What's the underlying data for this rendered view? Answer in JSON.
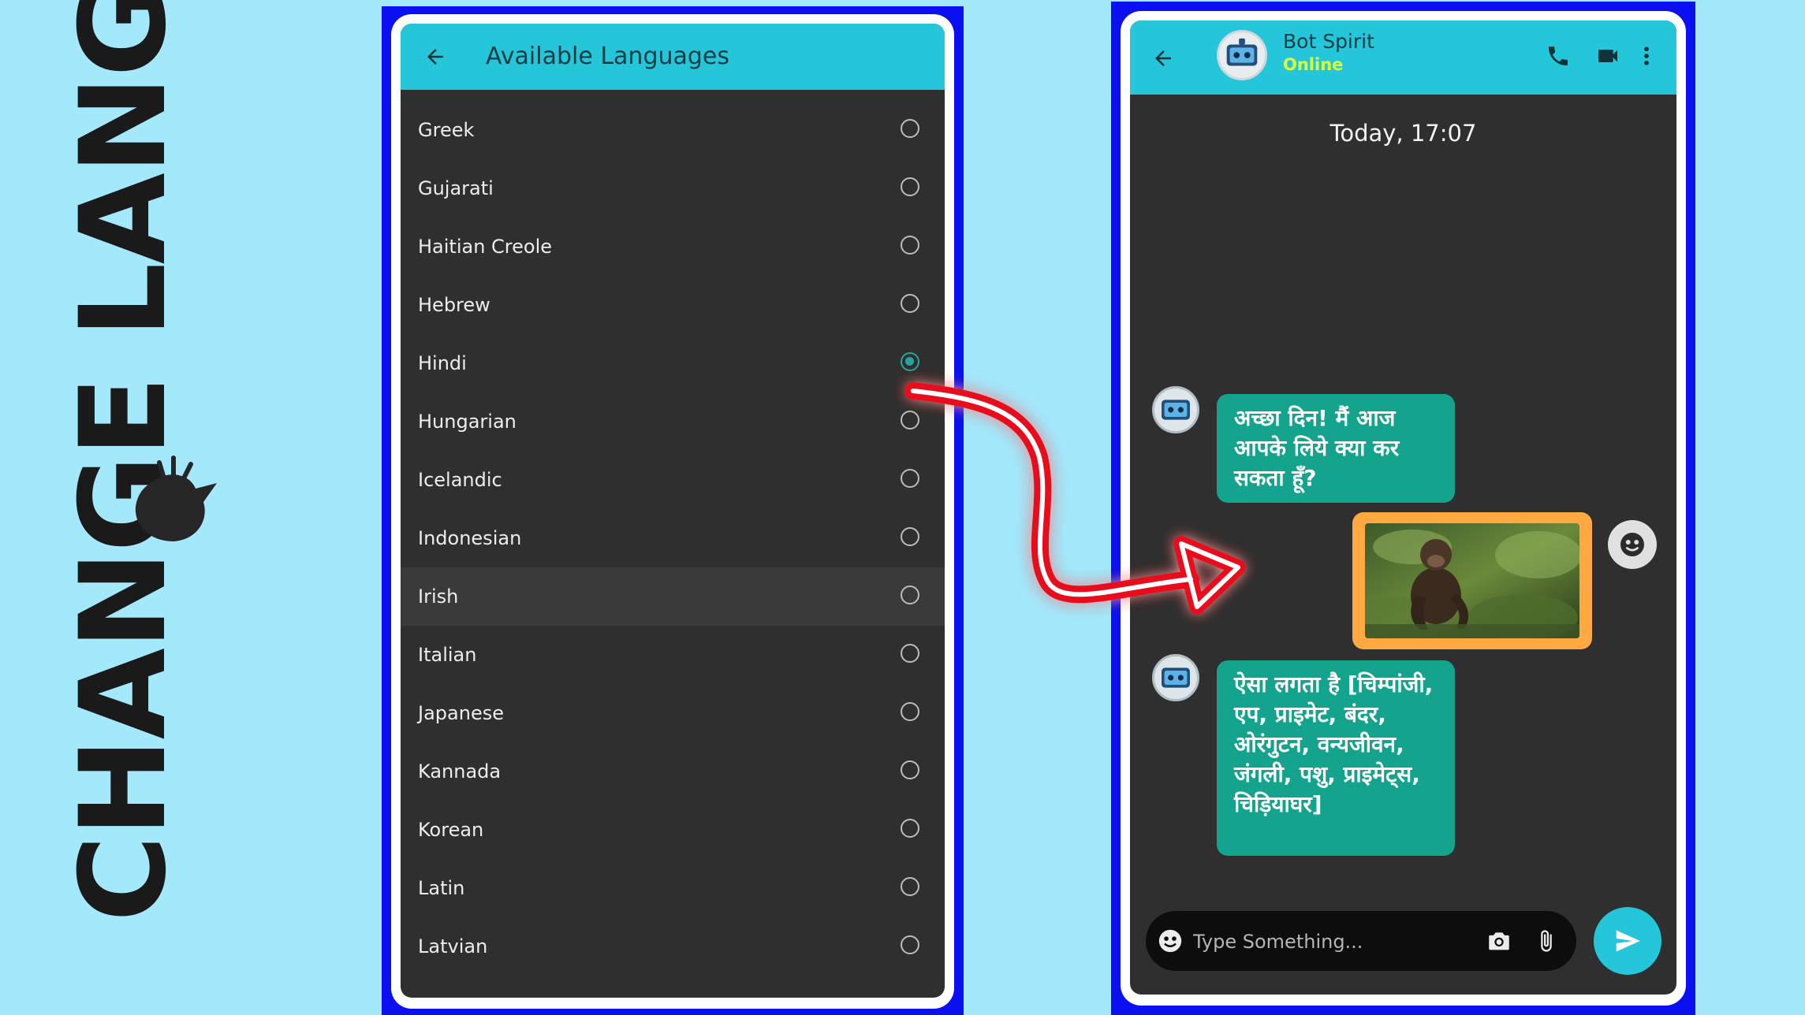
{
  "promo": {
    "title": "Change Languages"
  },
  "languages_screen": {
    "title": "Available Languages",
    "items": [
      {
        "label": "Greek",
        "selected": false
      },
      {
        "label": "Gujarati",
        "selected": false
      },
      {
        "label": "Haitian Creole",
        "selected": false
      },
      {
        "label": "Hebrew",
        "selected": false
      },
      {
        "label": "Hindi",
        "selected": true
      },
      {
        "label": "Hungarian",
        "selected": false
      },
      {
        "label": "Icelandic",
        "selected": false
      },
      {
        "label": "Indonesian",
        "selected": false
      },
      {
        "label": "Irish",
        "selected": false
      },
      {
        "label": "Italian",
        "selected": false
      },
      {
        "label": "Japanese",
        "selected": false
      },
      {
        "label": "Kannada",
        "selected": false
      },
      {
        "label": "Korean",
        "selected": false
      },
      {
        "label": "Latin",
        "selected": false
      },
      {
        "label": "Latvian",
        "selected": false
      }
    ]
  },
  "chat_screen": {
    "contact_name": "Bot Spirit",
    "contact_status": "Online",
    "date_chip": "Today, 17:07",
    "messages": {
      "greeting": "अच्छा दिन! मैं आज आपके लिये क्या कर सकता हूँ?",
      "reply": "ऐसा लगता है [चिम्पांजी, एप, प्राइमेट, बंदर, ओरंगुटन, वन्यजीवन, जंगली, पशु, प्राइमेट्स, चिड़ियाघर]"
    },
    "input_placeholder": "Type Something..."
  },
  "colors": {
    "background": "#a3e8fb",
    "frame": "#0a10f0",
    "appbar": "#26c6da",
    "screen": "#2f2f2f",
    "bubble": "#14a38c",
    "image_border": "#ffa940",
    "status_online": "#d9ff3a",
    "arrow": "#e8101a"
  },
  "icons": {
    "back": "arrow-left-icon",
    "call": "phone-icon",
    "video": "video-camera-icon",
    "menu": "more-vert-icon",
    "emoji": "emoji-icon",
    "camera": "camera-icon",
    "attach": "paperclip-icon",
    "send": "send-icon"
  }
}
